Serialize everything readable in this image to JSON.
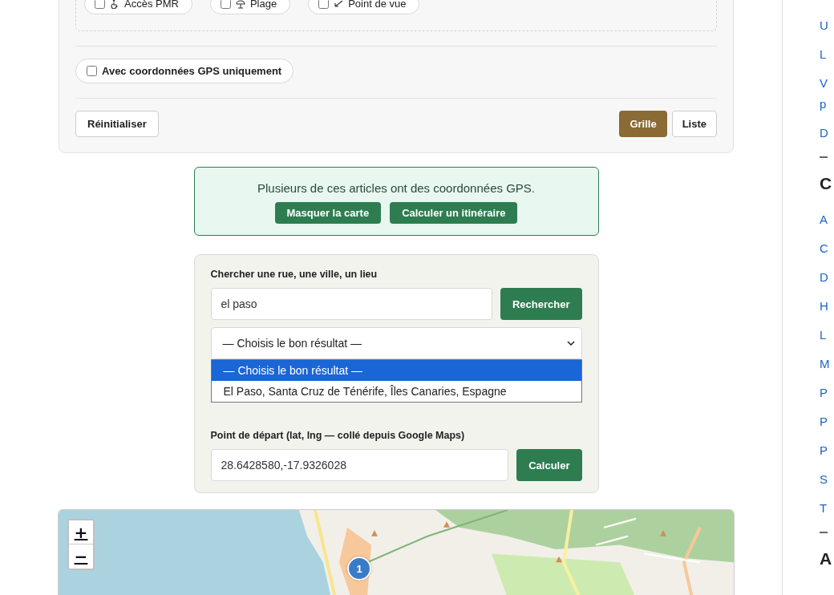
{
  "filters": {
    "chips": [
      {
        "label": "Accès PMR",
        "checked": false
      },
      {
        "label": "Plage",
        "checked": false
      },
      {
        "label": "Point de vue",
        "checked": false
      }
    ],
    "gps_only": {
      "label": "Avec coordonnées GPS uniquement",
      "checked": false
    },
    "reset": "Réinitialiser",
    "views": [
      {
        "label": "Grille",
        "selected": true
      },
      {
        "label": "Liste",
        "selected": false
      }
    ]
  },
  "notice": {
    "text": "Plusieurs de ces articles ont des coordonnées GPS.",
    "buttons": [
      "Masquer la carte",
      "Calculer un itinéraire"
    ]
  },
  "route": {
    "search_label": "Chercher une rue, une ville, un lieu",
    "search_value": "el paso",
    "search_button": "Rechercher",
    "select": {
      "value": "— Choisis le bon résultat —",
      "expanded": true,
      "options": [
        {
          "label": "— Choisis le bon résultat —",
          "selected": true
        },
        {
          "label": "El Paso, Santa Cruz de Ténérife, Îles Canaries, Espagne",
          "selected": false
        }
      ]
    },
    "start_label": "Point de départ (lat, lng — collé depuis Google Maps)",
    "start_value": "28.6428580,-17.9326028",
    "start_button": "Calculer"
  },
  "map": {
    "kind": "picture",
    "zoom": [
      "+",
      "−"
    ],
    "markers": [
      {
        "label": "1"
      }
    ]
  },
  "sidebar": [
    {
      "kind": "link",
      "text": "U"
    },
    {
      "kind": "link",
      "text": "L"
    },
    {
      "kind": "link",
      "text": "V p"
    },
    {
      "kind": "link",
      "text": "D"
    },
    {
      "kind": "rule"
    },
    {
      "kind": "heading",
      "text": "C"
    },
    {
      "kind": "link",
      "text": "A"
    },
    {
      "kind": "link",
      "text": "C"
    },
    {
      "kind": "link",
      "text": "D"
    },
    {
      "kind": "link",
      "text": "H"
    },
    {
      "kind": "link",
      "text": "L"
    },
    {
      "kind": "link",
      "text": "M"
    },
    {
      "kind": "link",
      "text": "P"
    },
    {
      "kind": "link",
      "text": "P"
    },
    {
      "kind": "link",
      "text": "P"
    },
    {
      "kind": "link",
      "text": "S"
    },
    {
      "kind": "link",
      "text": "T"
    },
    {
      "kind": "rule"
    },
    {
      "kind": "heading",
      "text": "A"
    }
  ]
}
